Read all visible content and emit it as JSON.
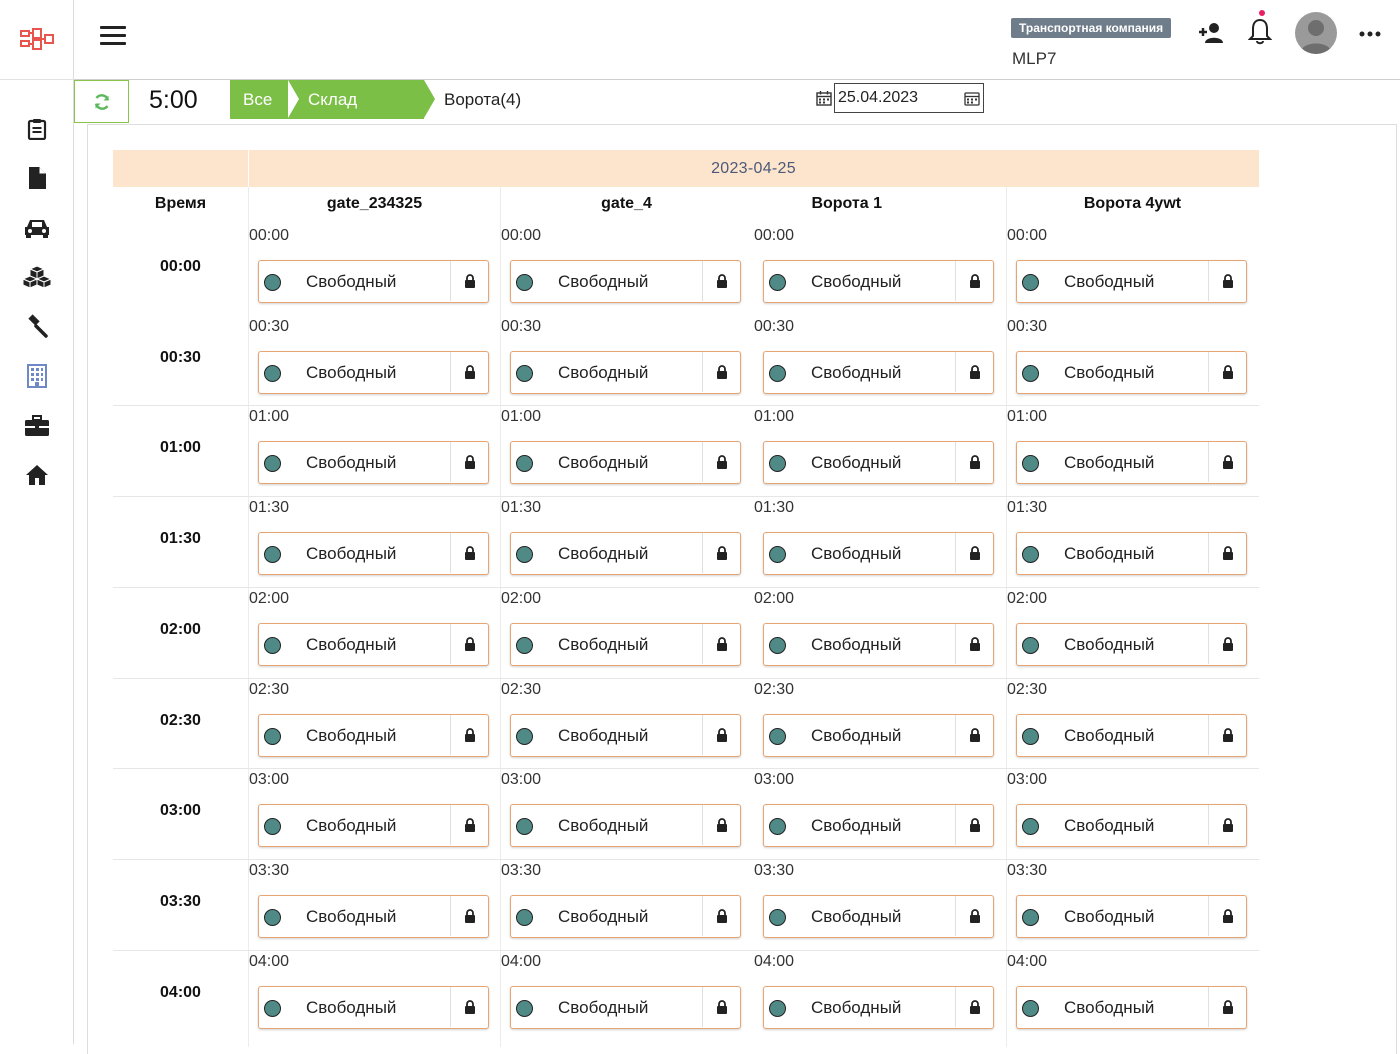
{
  "header": {
    "company_badge": "Транспортная компания",
    "company_user": "MLP7"
  },
  "toolbar": {
    "time": "5:00",
    "crumbs": {
      "all": "Все",
      "warehouse": "Склад",
      "gates": "Ворота(4)"
    },
    "date_value": "25.04.2023"
  },
  "sidebar": {
    "items": [
      "clipboard-icon",
      "document-icon",
      "car-icon",
      "boxes-icon",
      "hammer-icon",
      "building-icon",
      "briefcase-icon",
      "home-icon"
    ]
  },
  "schedule": {
    "date": "2023-04-25",
    "time_column_header": "Время",
    "gates": [
      "gate_234325",
      "gate_4",
      "Ворота 1",
      "Ворота 4ywt"
    ],
    "slot_status": "Свободный",
    "rows": [
      {
        "time": "00:00"
      },
      {
        "time": "00:30"
      },
      {
        "time": "01:00"
      },
      {
        "time": "01:30"
      },
      {
        "time": "02:00"
      },
      {
        "time": "02:30"
      },
      {
        "time": "03:00"
      },
      {
        "time": "03:30"
      },
      {
        "time": "04:00"
      }
    ]
  },
  "colors": {
    "accent_green": "#7cbf47",
    "date_header_bg": "#fde4cc",
    "slot_border": "#e8a574",
    "status_dot": "#4f8a87",
    "badge_bg": "#6f7c8a",
    "notification_dot": "#e91e63"
  }
}
